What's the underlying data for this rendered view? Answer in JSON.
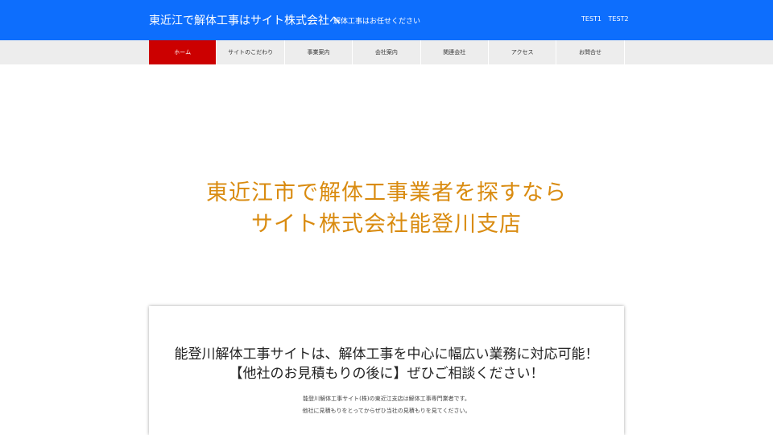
{
  "header": {
    "site_title": "東近江で解体工事はサイト株式会社へ",
    "tagline": "解体工事はお任せください",
    "links": [
      "TEST1",
      "TEST2"
    ],
    "background_color": "#0d6efd"
  },
  "nav": {
    "items": [
      {
        "label": "ホーム",
        "active": true
      },
      {
        "label": "サイトのこだわり",
        "active": false
      },
      {
        "label": "事業案内",
        "active": false
      },
      {
        "label": "会社案内",
        "active": false
      },
      {
        "label": "関連会社",
        "active": false
      },
      {
        "label": "アクセス",
        "active": false
      },
      {
        "label": "お問合せ",
        "active": false
      }
    ],
    "active_color": "#cc0000"
  },
  "hero": {
    "title_line1": "東近江市で解体工事業者を探すなら",
    "title_line2": "サイト株式会社能登川支店",
    "title_color": "#d98b10"
  },
  "intro": {
    "heading_line1": "能登川解体工事サイトは、解体工事を中心に幅広い業務に対応可能！",
    "heading_line2": "【他社のお見積もりの後に】ぜひご相談ください！",
    "text_line1": "能登川解体工事サイト(株)の東近江支店は解体工事専門業者です。",
    "text_line2": "他社に見積もりをとってからぜひ当社の見積もりを見てください。"
  }
}
